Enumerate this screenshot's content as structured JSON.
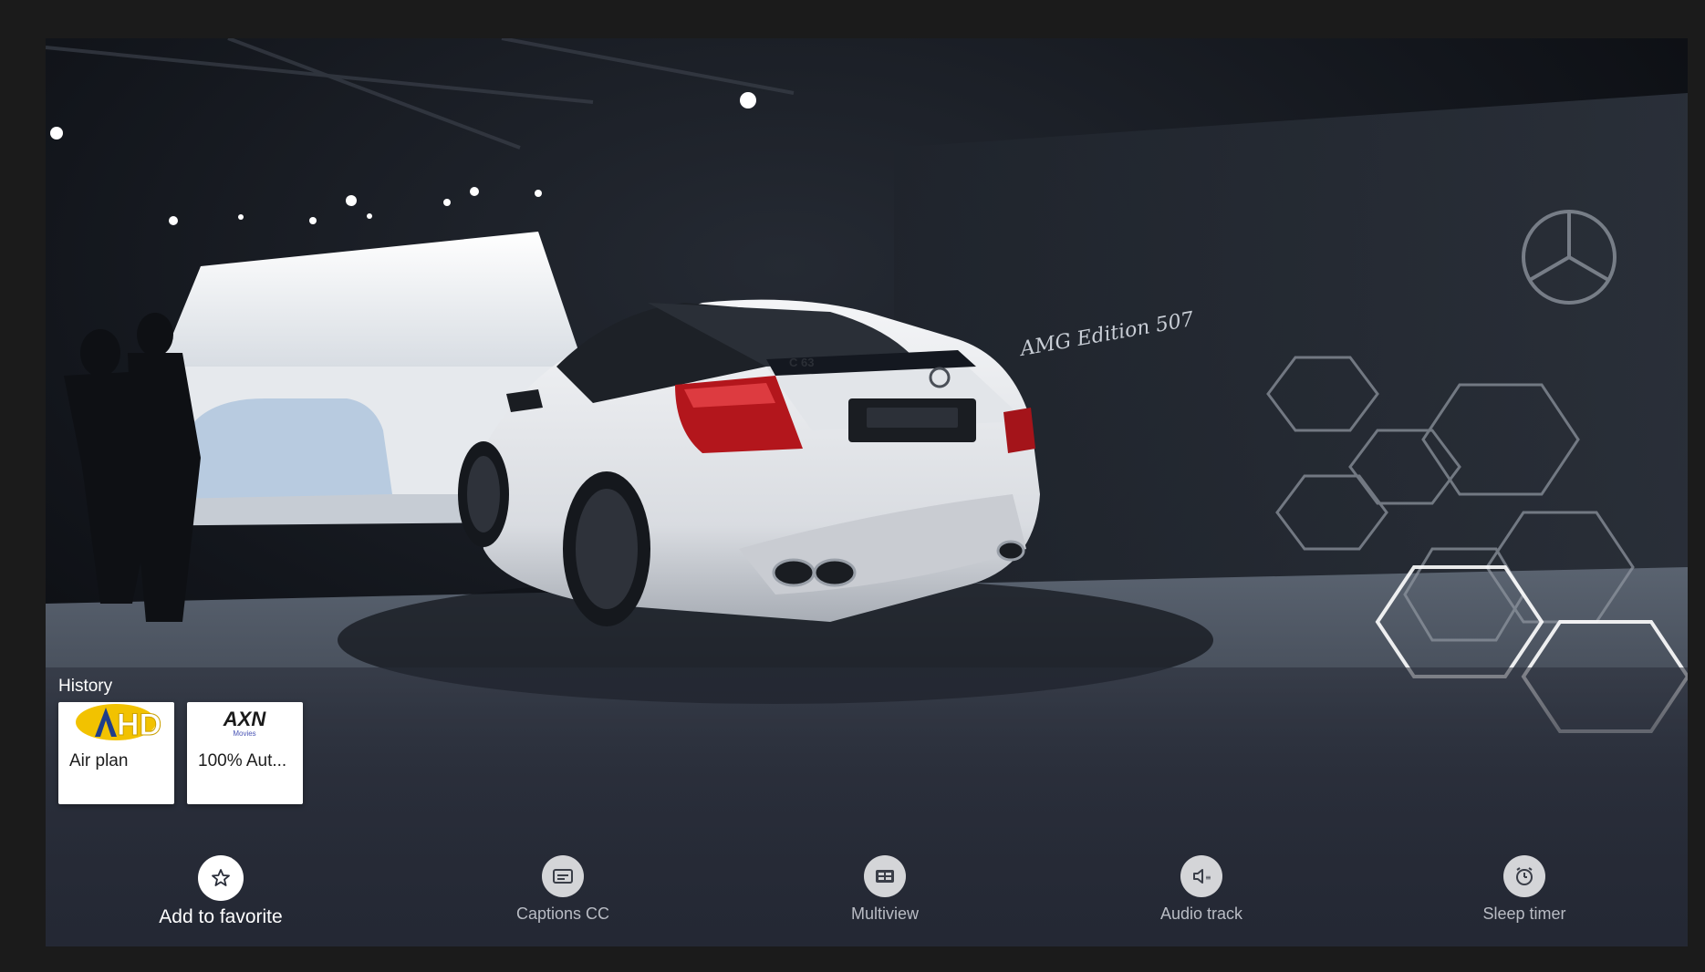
{
  "history": {
    "title": "History",
    "cards": [
      {
        "title": "Air plan",
        "logo": "channel-logo-hd"
      },
      {
        "title": "100% Aut...",
        "logo": "channel-logo-axn-movies",
        "logo_text": "AXN",
        "logo_sub": "Movies"
      }
    ]
  },
  "actions": [
    {
      "label": "Add to favorite",
      "icon": "star-icon",
      "focused": true
    },
    {
      "label": "Captions CC",
      "icon": "captions-icon",
      "focused": false
    },
    {
      "label": "Multiview",
      "icon": "multiview-icon",
      "focused": false
    },
    {
      "label": "Audio track",
      "icon": "audio-track-icon",
      "focused": false
    },
    {
      "label": "Sleep timer",
      "icon": "alarm-clock-icon",
      "focused": false
    }
  ],
  "video": {
    "overlay_text": "AMG Edition 507",
    "badge_text": "C 63"
  },
  "colors": {
    "background": "#1b1b1b",
    "panel": "#2a2e3a",
    "focus": "#ffffff",
    "icon_circle": "#d4d5d8"
  }
}
